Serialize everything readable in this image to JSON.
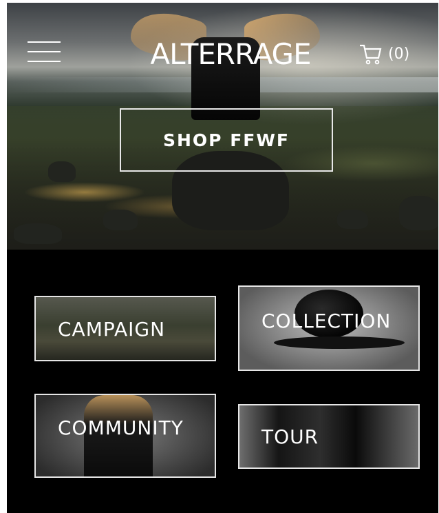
{
  "header": {
    "logo_text": "ALTERRAGE",
    "cart_count": "(0)"
  },
  "hero": {
    "cta_label": "SHOP FFWF"
  },
  "cards": [
    {
      "label": "CAMPAIGN"
    },
    {
      "label": "COLLECTION"
    },
    {
      "label": "COMMUNITY"
    },
    {
      "label": "TOUR"
    }
  ],
  "colors": {
    "background": "#000000",
    "text": "#ffffff",
    "card_border": "#e6e6e6"
  },
  "icons": [
    "menu-icon",
    "cart-icon"
  ]
}
